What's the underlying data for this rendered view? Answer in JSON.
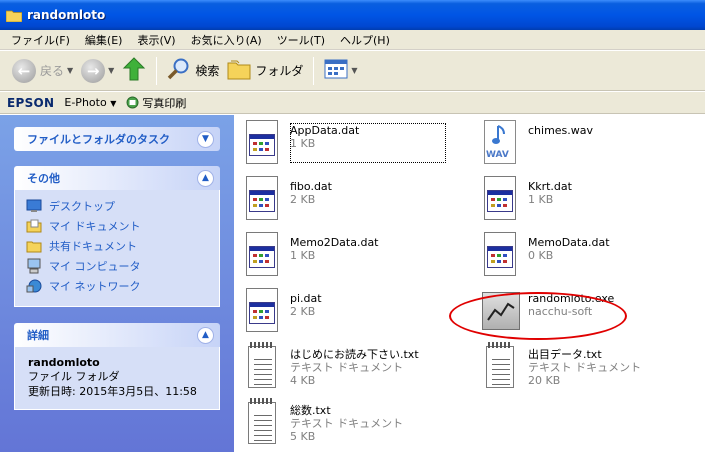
{
  "window": {
    "title": "randomloto"
  },
  "menu": [
    "ファイル(F)",
    "編集(E)",
    "表示(V)",
    "お気に入り(A)",
    "ツール(T)",
    "ヘルプ(H)"
  ],
  "toolbar": {
    "back": "戻る",
    "search": "検索",
    "folders": "フォルダ"
  },
  "epson": {
    "brand": "EPSON",
    "ephoto": "E-Photo",
    "print": "写真印刷"
  },
  "tasks_panel": {
    "title": "ファイルとフォルダのタスク"
  },
  "other_panel": {
    "title": "その他",
    "links": [
      "デスクトップ",
      "マイ ドキュメント",
      "共有ドキュメント",
      "マイ コンピュータ",
      "マイ ネットワーク"
    ]
  },
  "details_panel": {
    "title": "詳細",
    "name": "randomloto",
    "type": "ファイル フォルダ",
    "modified": "更新日時: 2015年3月5日、11:58"
  },
  "files": [
    {
      "name": "AppData.dat",
      "type": "",
      "size": "1 KB",
      "icon": "dat-file-icon"
    },
    {
      "name": "chimes.wav",
      "type": "",
      "size": "",
      "icon": "wav-file-icon"
    },
    {
      "name": "fibo.dat",
      "type": "",
      "size": "2 KB",
      "icon": "dat-file-icon"
    },
    {
      "name": "Kkrt.dat",
      "type": "",
      "size": "1 KB",
      "icon": "dat-file-icon"
    },
    {
      "name": "Memo2Data.dat",
      "type": "",
      "size": "1 KB",
      "icon": "dat-file-icon"
    },
    {
      "name": "MemoData.dat",
      "type": "",
      "size": "0 KB",
      "icon": "dat-file-icon"
    },
    {
      "name": "pi.dat",
      "type": "",
      "size": "2 KB",
      "icon": "dat-file-icon"
    },
    {
      "name": "randomloto.exe",
      "type": "nacchu-soft",
      "size": "",
      "icon": "exe-file-icon"
    },
    {
      "name": "はじめにお読み下さい.txt",
      "type": "テキスト ドキュメント",
      "size": "4 KB",
      "icon": "txt-file-icon"
    },
    {
      "name": "出目データ.txt",
      "type": "テキスト ドキュメント",
      "size": "20 KB",
      "icon": "txt-file-icon"
    },
    {
      "name": "総数.txt",
      "type": "テキスト ドキュメント",
      "size": "5 KB",
      "icon": "txt-file-icon"
    }
  ],
  "colors": {
    "titlebar": "#0055e5",
    "taskpane": "#6375d6",
    "link": "#215dc6",
    "highlight": "#e00000"
  }
}
